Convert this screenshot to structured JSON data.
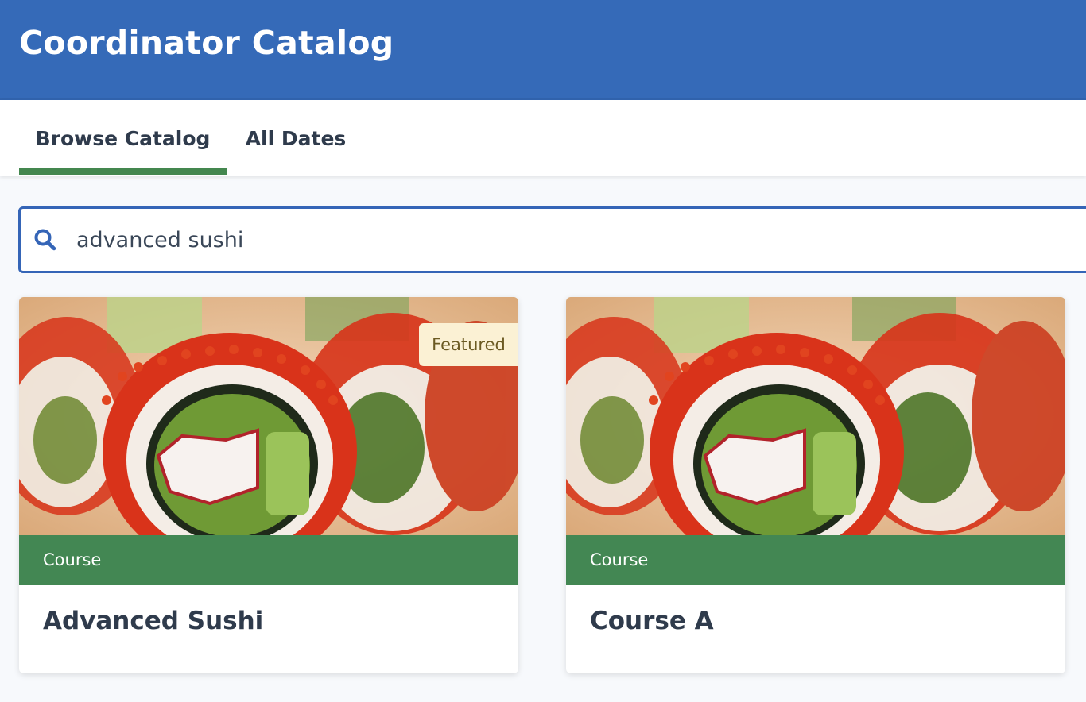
{
  "app": {
    "title": "Coordinator Catalog"
  },
  "tabs": [
    {
      "label": "Browse Catalog",
      "active": true
    },
    {
      "label": "All Dates",
      "active": false
    }
  ],
  "search": {
    "value": "advanced sushi",
    "icon": "search-icon"
  },
  "cards": [
    {
      "type_label": "Course",
      "title": "Advanced Sushi",
      "badge": "Featured",
      "image": "sushi-rolls-photo"
    },
    {
      "type_label": "Course",
      "title": "Course A",
      "badge": "",
      "image": "sushi-rolls-photo"
    }
  ],
  "colors": {
    "header": "#356ab8",
    "tab_underline": "#44874f",
    "card_strip": "#438753",
    "badge_bg": "#fbf1d4",
    "search_border": "#3565b7"
  }
}
